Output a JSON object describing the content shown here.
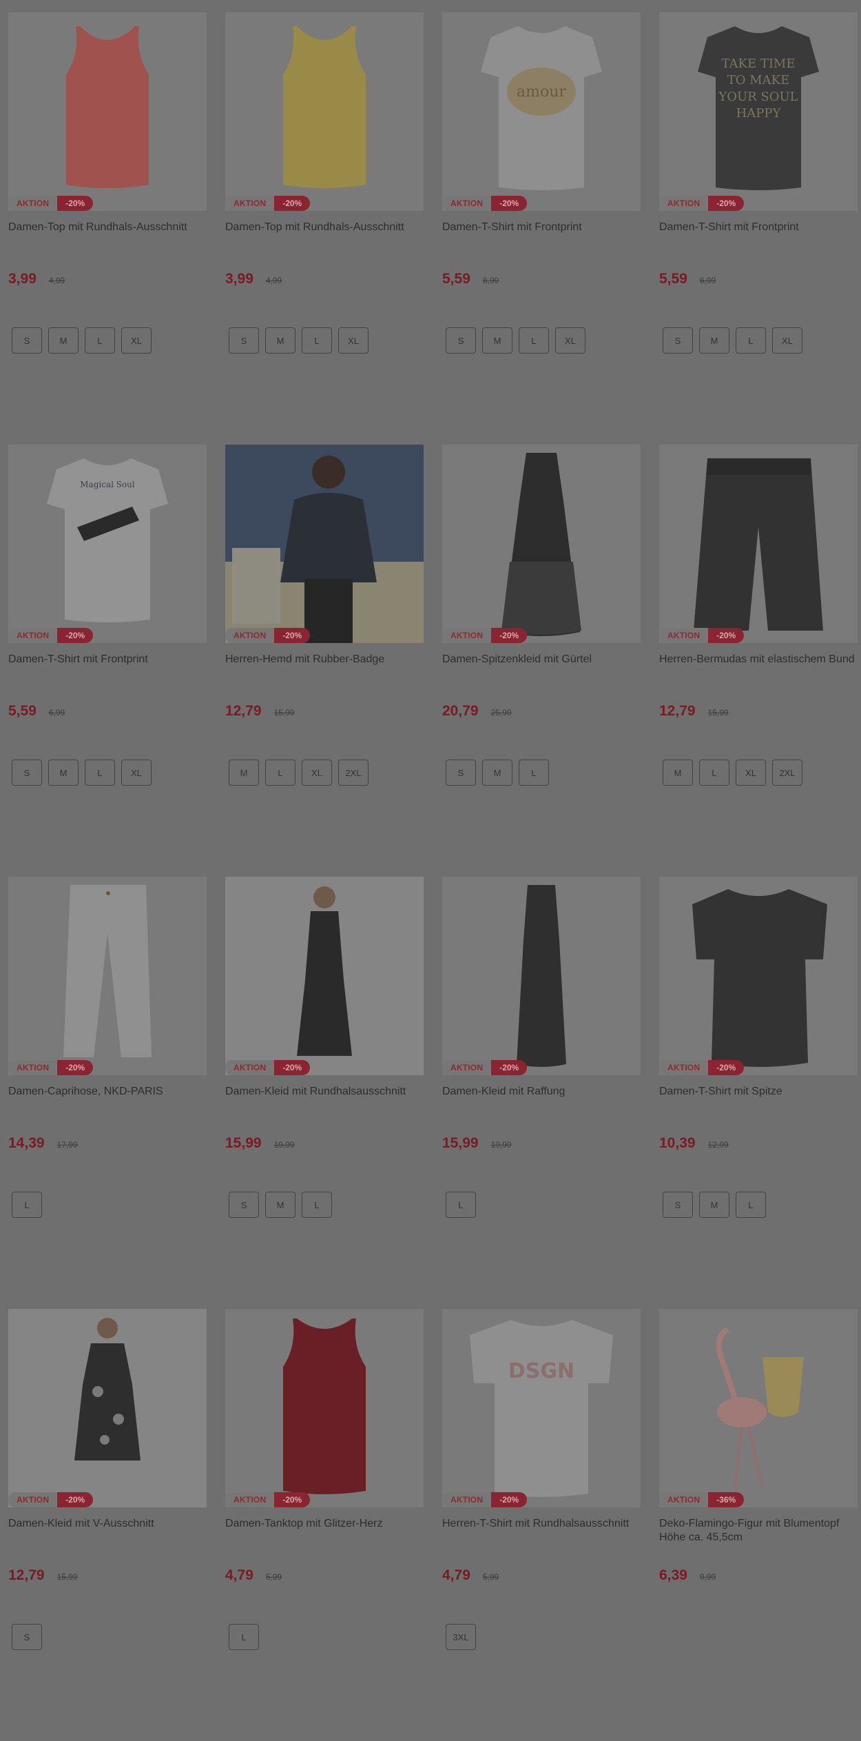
{
  "badge_label": "AKTION",
  "products": [
    {
      "title": "Damen-Top mit Rundhals-Ausschnitt",
      "price": "3,99",
      "old_price": "4,99",
      "discount": "-20%",
      "sizes": [
        "S",
        "M",
        "L",
        "XL"
      ],
      "image": "tank-top-coral"
    },
    {
      "title": "Damen-Top mit Rundhals-Ausschnitt",
      "price": "3,99",
      "old_price": "4,99",
      "discount": "-20%",
      "sizes": [
        "S",
        "M",
        "L",
        "XL"
      ],
      "image": "tank-top-yellow"
    },
    {
      "title": "Damen-T-Shirt mit Frontprint",
      "price": "5,59",
      "old_price": "6,99",
      "discount": "-20%",
      "sizes": [
        "S",
        "M",
        "L",
        "XL"
      ],
      "image": "tshirt-white-amour-print"
    },
    {
      "title": "Damen-T-Shirt mit Frontprint",
      "price": "5,59",
      "old_price": "6,99",
      "discount": "-20%",
      "sizes": [
        "S",
        "M",
        "L",
        "XL"
      ],
      "image": "tshirt-dark-take-time-print"
    },
    {
      "title": "Damen-T-Shirt mit Frontprint",
      "price": "5,59",
      "old_price": "6,99",
      "discount": "-20%",
      "sizes": [
        "S",
        "M",
        "L",
        "XL"
      ],
      "image": "tshirt-white-magical-soul-print"
    },
    {
      "title": "Herren-Hemd mit Rubber-Badge",
      "price": "12,79",
      "old_price": "15,99",
      "discount": "-20%",
      "sizes": [
        "M",
        "L",
        "XL",
        "2XL"
      ],
      "image": "man-dark-shirt-photo"
    },
    {
      "title": "Damen-Spitzenkleid mit Gürtel",
      "price": "20,79",
      "old_price": "25,99",
      "discount": "-20%",
      "sizes": [
        "S",
        "M",
        "L"
      ],
      "image": "black-lace-dress"
    },
    {
      "title": "Herren-Bermudas mit elastischem Bund",
      "price": "12,79",
      "old_price": "15,99",
      "discount": "-20%",
      "sizes": [
        "M",
        "L",
        "XL",
        "2XL"
      ],
      "image": "black-bermuda-shorts"
    },
    {
      "title": "Damen-Caprihose, NKD-PARIS",
      "price": "14,39",
      "old_price": "17,99",
      "discount": "-20%",
      "sizes": [
        "L"
      ],
      "image": "white-capri-pants"
    },
    {
      "title": "Damen-Kleid mit Rundhalsausschnitt",
      "price": "15,99",
      "old_price": "19,99",
      "discount": "-20%",
      "sizes": [
        "S",
        "M",
        "L"
      ],
      "image": "woman-black-dress-photo"
    },
    {
      "title": "Damen-Kleid mit Raffung",
      "price": "15,99",
      "old_price": "19,99",
      "discount": "-20%",
      "sizes": [
        "L"
      ],
      "image": "black-maxi-dress"
    },
    {
      "title": "Damen-T-Shirt mit Spitze",
      "price": "10,39",
      "old_price": "12,99",
      "discount": "-20%",
      "sizes": [
        "S",
        "M",
        "L"
      ],
      "image": "black-tshirt-lace"
    },
    {
      "title": "Damen-Kleid mit V-Ausschnitt",
      "price": "12,79",
      "old_price": "15,99",
      "discount": "-20%",
      "sizes": [
        "S"
      ],
      "image": "woman-floral-dress-photo"
    },
    {
      "title": "Damen-Tanktop mit Glitzer-Herz",
      "price": "4,79",
      "old_price": "5,99",
      "discount": "-20%",
      "sizes": [
        "L"
      ],
      "image": "red-tanktop"
    },
    {
      "title": "Herren-T-Shirt mit Rundhalsausschnitt",
      "price": "4,79",
      "old_price": "5,99",
      "discount": "-20%",
      "sizes": [
        "3XL"
      ],
      "image": "white-tshirt-dsgn-print"
    },
    {
      "title": "Deko-Flamingo-Figur mit Blumentopf Höhe ca. 45,5cm",
      "price": "6,39",
      "old_price": "9,99",
      "discount": "-36%",
      "sizes": [],
      "image": "flamingo-figure-planter"
    }
  ],
  "colors": {
    "overlay": "#6f6f6f",
    "price": "#7a1a22",
    "discount_bg": "#8a2430"
  }
}
